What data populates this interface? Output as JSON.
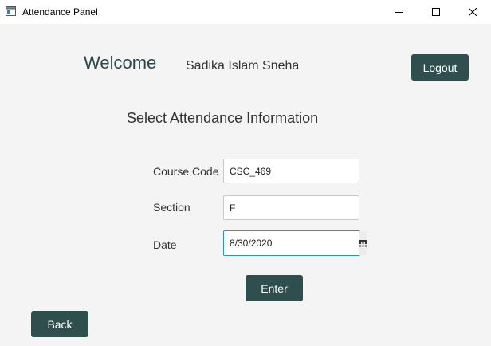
{
  "window": {
    "title": "Attendance Panel",
    "icons": {
      "app": "app-window-icon",
      "minimize": "minimize-icon",
      "maximize": "maximize-icon",
      "close": "close-icon"
    }
  },
  "header": {
    "welcome": "Welcome",
    "user_name": "Sadika Islam Sneha",
    "logout_label": "Logout"
  },
  "form": {
    "heading": "Select Attendance Information",
    "course_code": {
      "label": "Course Code",
      "value": "CSC_469"
    },
    "section": {
      "label": "Section",
      "value": "F"
    },
    "date": {
      "label": "Date",
      "value": "8/30/2020",
      "icon": "calendar-icon"
    },
    "enter_label": "Enter"
  },
  "footer": {
    "back_label": "Back"
  },
  "colors": {
    "button_bg": "#2f4f4f",
    "button_text": "#ffffff",
    "welcome_text": "#2a4850",
    "focus_border": "#2b8fd6",
    "background": "#f4f4f4"
  }
}
